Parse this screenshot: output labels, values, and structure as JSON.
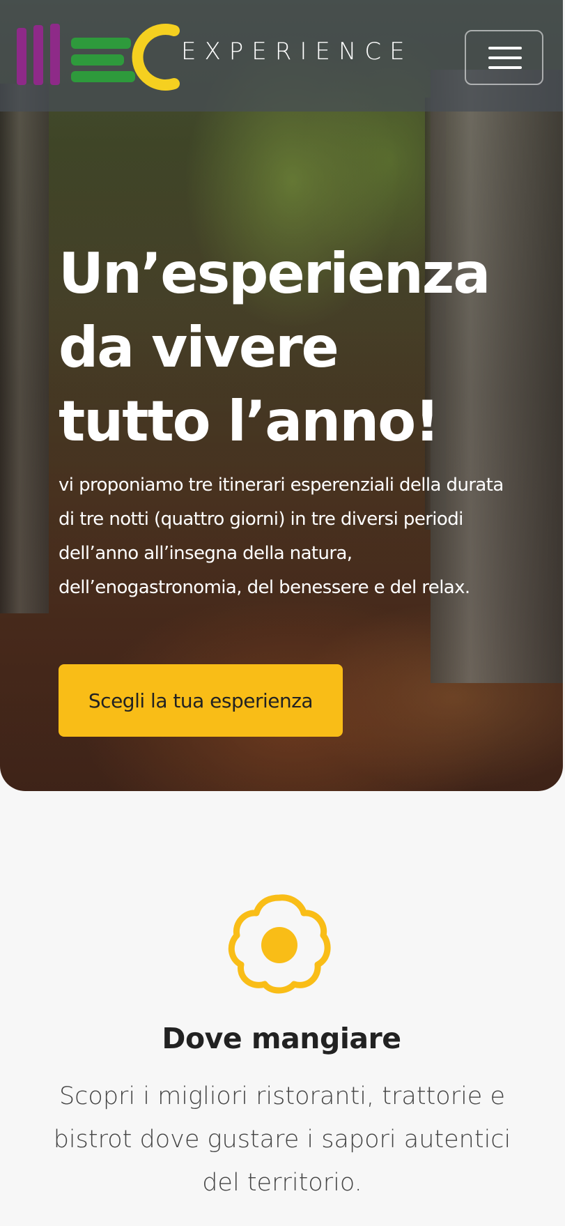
{
  "navbar": {
    "logo_text": "EXPERIENCE",
    "menu_icon": "hamburger-menu-icon"
  },
  "hero": {
    "title": "Un’esperienza da vivere tutto l’anno!",
    "text": "vi proponiamo tre itinerari esperenziali della durata di tre notti (quattro giorni) in tre diversi periodi dell’anno all’insegna della natura, dell’enogastronomia, del benessere e del relax.",
    "cta_label": "Scegli la tua esperienza"
  },
  "feature": {
    "icon": "fried-egg-icon",
    "title": "Dove mangiare",
    "text": "Scopri i migliori ristoranti, trattorie e bistrot dove gustare i sapori autentici del territorio."
  },
  "colors": {
    "accent": "#f9bd17",
    "logo_purple": "#8e2a88",
    "logo_green": "#2e9a3c",
    "logo_yellow": "#f5d020",
    "nav_overlay": "#464e56"
  }
}
